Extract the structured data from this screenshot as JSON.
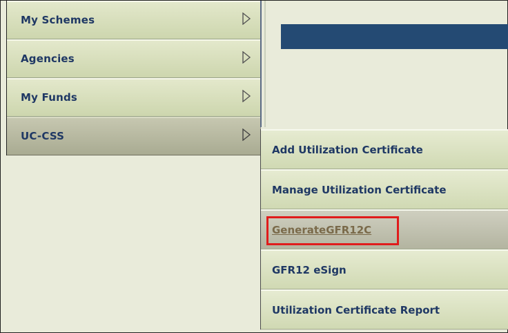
{
  "nav": {
    "items": [
      {
        "label": "My Schemes"
      },
      {
        "label": "Agencies"
      },
      {
        "label": "My Funds"
      },
      {
        "label": "UC-CSS"
      }
    ]
  },
  "submenu": {
    "items": [
      {
        "label": "Add Utilization Certificate"
      },
      {
        "label": "Manage Utilization Certificate"
      },
      {
        "label": "GenerateGFR12C"
      },
      {
        "label": "GFR12 eSign"
      },
      {
        "label": "Utilization Certificate Report"
      }
    ]
  },
  "colors": {
    "header_bar": "#244a73",
    "highlight_box": "#e01b1b",
    "label_text": "#1f3864"
  },
  "icons": {
    "nav_arrow": "triangle-right-outline-icon"
  }
}
